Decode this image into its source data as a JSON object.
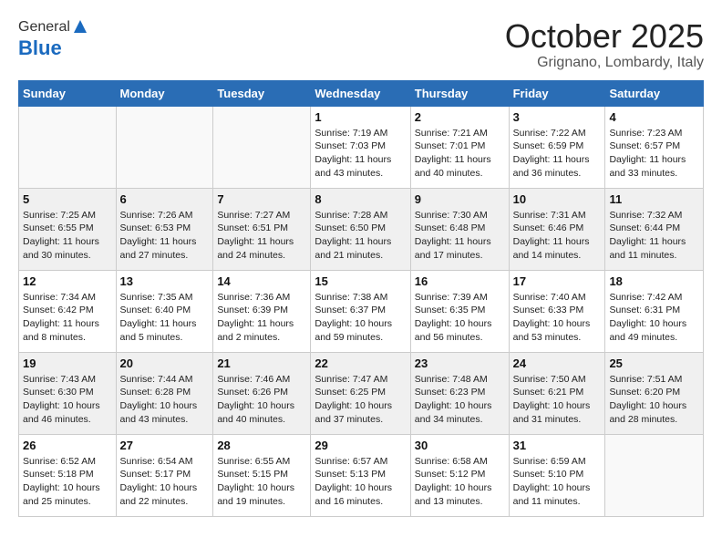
{
  "header": {
    "logo_line1": "General",
    "logo_line2": "Blue",
    "month": "October 2025",
    "location": "Grignano, Lombardy, Italy"
  },
  "days_of_week": [
    "Sunday",
    "Monday",
    "Tuesday",
    "Wednesday",
    "Thursday",
    "Friday",
    "Saturday"
  ],
  "weeks": [
    [
      {
        "day": "",
        "info": ""
      },
      {
        "day": "",
        "info": ""
      },
      {
        "day": "",
        "info": ""
      },
      {
        "day": "1",
        "info": "Sunrise: 7:19 AM\nSunset: 7:03 PM\nDaylight: 11 hours\nand 43 minutes."
      },
      {
        "day": "2",
        "info": "Sunrise: 7:21 AM\nSunset: 7:01 PM\nDaylight: 11 hours\nand 40 minutes."
      },
      {
        "day": "3",
        "info": "Sunrise: 7:22 AM\nSunset: 6:59 PM\nDaylight: 11 hours\nand 36 minutes."
      },
      {
        "day": "4",
        "info": "Sunrise: 7:23 AM\nSunset: 6:57 PM\nDaylight: 11 hours\nand 33 minutes."
      }
    ],
    [
      {
        "day": "5",
        "info": "Sunrise: 7:25 AM\nSunset: 6:55 PM\nDaylight: 11 hours\nand 30 minutes."
      },
      {
        "day": "6",
        "info": "Sunrise: 7:26 AM\nSunset: 6:53 PM\nDaylight: 11 hours\nand 27 minutes."
      },
      {
        "day": "7",
        "info": "Sunrise: 7:27 AM\nSunset: 6:51 PM\nDaylight: 11 hours\nand 24 minutes."
      },
      {
        "day": "8",
        "info": "Sunrise: 7:28 AM\nSunset: 6:50 PM\nDaylight: 11 hours\nand 21 minutes."
      },
      {
        "day": "9",
        "info": "Sunrise: 7:30 AM\nSunset: 6:48 PM\nDaylight: 11 hours\nand 17 minutes."
      },
      {
        "day": "10",
        "info": "Sunrise: 7:31 AM\nSunset: 6:46 PM\nDaylight: 11 hours\nand 14 minutes."
      },
      {
        "day": "11",
        "info": "Sunrise: 7:32 AM\nSunset: 6:44 PM\nDaylight: 11 hours\nand 11 minutes."
      }
    ],
    [
      {
        "day": "12",
        "info": "Sunrise: 7:34 AM\nSunset: 6:42 PM\nDaylight: 11 hours\nand 8 minutes."
      },
      {
        "day": "13",
        "info": "Sunrise: 7:35 AM\nSunset: 6:40 PM\nDaylight: 11 hours\nand 5 minutes."
      },
      {
        "day": "14",
        "info": "Sunrise: 7:36 AM\nSunset: 6:39 PM\nDaylight: 11 hours\nand 2 minutes."
      },
      {
        "day": "15",
        "info": "Sunrise: 7:38 AM\nSunset: 6:37 PM\nDaylight: 10 hours\nand 59 minutes."
      },
      {
        "day": "16",
        "info": "Sunrise: 7:39 AM\nSunset: 6:35 PM\nDaylight: 10 hours\nand 56 minutes."
      },
      {
        "day": "17",
        "info": "Sunrise: 7:40 AM\nSunset: 6:33 PM\nDaylight: 10 hours\nand 53 minutes."
      },
      {
        "day": "18",
        "info": "Sunrise: 7:42 AM\nSunset: 6:31 PM\nDaylight: 10 hours\nand 49 minutes."
      }
    ],
    [
      {
        "day": "19",
        "info": "Sunrise: 7:43 AM\nSunset: 6:30 PM\nDaylight: 10 hours\nand 46 minutes."
      },
      {
        "day": "20",
        "info": "Sunrise: 7:44 AM\nSunset: 6:28 PM\nDaylight: 10 hours\nand 43 minutes."
      },
      {
        "day": "21",
        "info": "Sunrise: 7:46 AM\nSunset: 6:26 PM\nDaylight: 10 hours\nand 40 minutes."
      },
      {
        "day": "22",
        "info": "Sunrise: 7:47 AM\nSunset: 6:25 PM\nDaylight: 10 hours\nand 37 minutes."
      },
      {
        "day": "23",
        "info": "Sunrise: 7:48 AM\nSunset: 6:23 PM\nDaylight: 10 hours\nand 34 minutes."
      },
      {
        "day": "24",
        "info": "Sunrise: 7:50 AM\nSunset: 6:21 PM\nDaylight: 10 hours\nand 31 minutes."
      },
      {
        "day": "25",
        "info": "Sunrise: 7:51 AM\nSunset: 6:20 PM\nDaylight: 10 hours\nand 28 minutes."
      }
    ],
    [
      {
        "day": "26",
        "info": "Sunrise: 6:52 AM\nSunset: 5:18 PM\nDaylight: 10 hours\nand 25 minutes."
      },
      {
        "day": "27",
        "info": "Sunrise: 6:54 AM\nSunset: 5:17 PM\nDaylight: 10 hours\nand 22 minutes."
      },
      {
        "day": "28",
        "info": "Sunrise: 6:55 AM\nSunset: 5:15 PM\nDaylight: 10 hours\nand 19 minutes."
      },
      {
        "day": "29",
        "info": "Sunrise: 6:57 AM\nSunset: 5:13 PM\nDaylight: 10 hours\nand 16 minutes."
      },
      {
        "day": "30",
        "info": "Sunrise: 6:58 AM\nSunset: 5:12 PM\nDaylight: 10 hours\nand 13 minutes."
      },
      {
        "day": "31",
        "info": "Sunrise: 6:59 AM\nSunset: 5:10 PM\nDaylight: 10 hours\nand 11 minutes."
      },
      {
        "day": "",
        "info": ""
      }
    ]
  ]
}
